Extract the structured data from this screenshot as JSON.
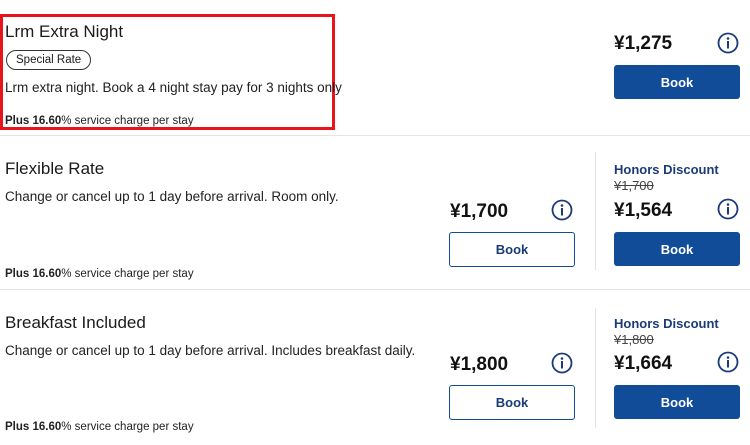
{
  "rates": [
    {
      "title": "Lrm Extra Night",
      "badge": "Special Rate",
      "description": "Lrm extra night. Book a 4 night stay pay for 3 nights only",
      "service_bold": "Plus 16.60",
      "service_rest": "% service charge per stay",
      "price": "¥1,275",
      "book_label": "Book"
    },
    {
      "title": "Flexible Rate",
      "description": "Change or cancel up to 1 day before arrival. Room only.",
      "service_bold": "Plus 16.60",
      "service_rest": "% service charge per stay",
      "price": "¥1,700",
      "book_label": "Book",
      "honors_label": "Honors Discount",
      "honors_original": "¥1,700",
      "honors_price": "¥1,564",
      "honors_book_label": "Book"
    },
    {
      "title": "Breakfast Included",
      "description": "Change or cancel up to 1 day before arrival. Includes breakfast daily.",
      "service_bold": "Plus 16.60",
      "service_rest": "% service charge per stay",
      "price": "¥1,800",
      "book_label": "Book",
      "honors_label": "Honors Discount",
      "honors_original": "¥1,800",
      "honors_price": "¥1,664",
      "honors_book_label": "Book"
    }
  ],
  "colors": {
    "highlight": "#e8141b",
    "primary_button": "#104c97",
    "honors_text": "#1b3b78",
    "divider": "#e4e4e4"
  },
  "icons": [
    "info-icon"
  ]
}
